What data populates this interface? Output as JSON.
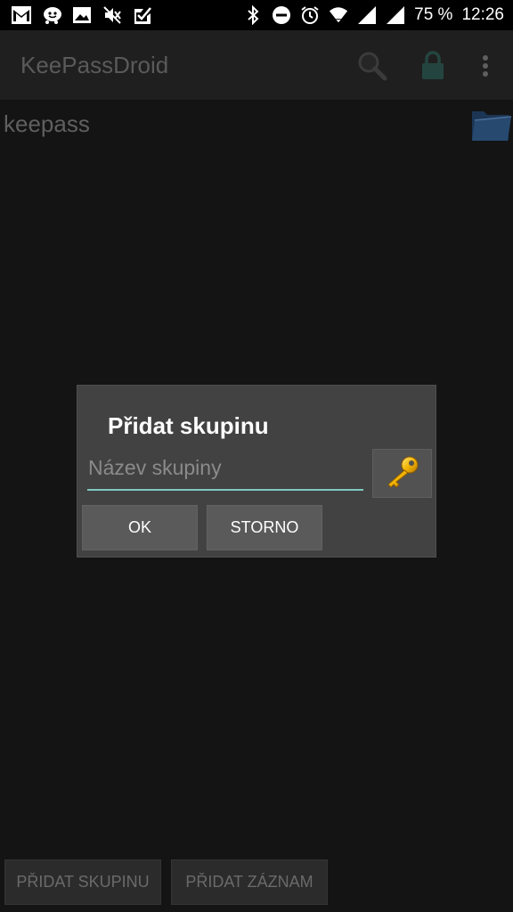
{
  "status_bar": {
    "left_icons": [
      "gmail-icon",
      "waze-icon",
      "gallery-icon",
      "mute-icon",
      "check-app-icon"
    ],
    "right_icons": [
      "bluetooth-icon",
      "do-not-disturb-icon",
      "alarm-icon",
      "wifi-icon",
      "signal-icon",
      "signal-icon"
    ],
    "battery": "75 %",
    "time": "12:26"
  },
  "action_bar": {
    "title": "KeePassDroid",
    "icons": [
      "search-icon",
      "lock-icon",
      "overflow-menu-icon"
    ]
  },
  "group": {
    "name": "keepass",
    "icon": "folder-icon"
  },
  "dialog": {
    "title": "Přidat skupinu",
    "input_placeholder": "Název skupiny",
    "input_value": "",
    "icon_button": "key-icon",
    "ok_label": "OK",
    "cancel_label": "STORNO",
    "input_accent": "#7ec8c2"
  },
  "bottom_bar": {
    "add_group_label": "PŘIDAT SKUPINU",
    "add_entry_label": "PŘIDAT ZÁZNAM"
  }
}
